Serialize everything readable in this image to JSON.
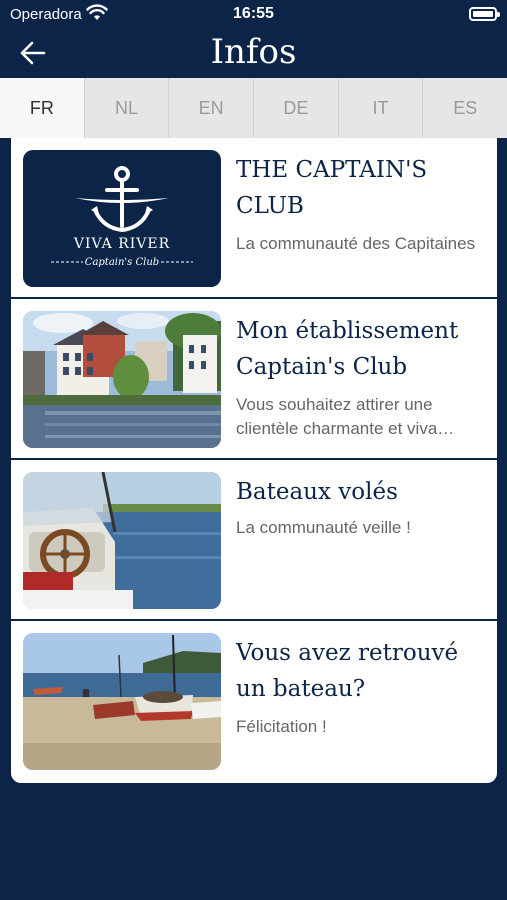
{
  "status_bar": {
    "carrier": "Operadora",
    "time": "16:55"
  },
  "nav": {
    "title": "Infos"
  },
  "languages": [
    {
      "code": "FR",
      "active": true
    },
    {
      "code": "NL",
      "active": false
    },
    {
      "code": "EN",
      "active": false
    },
    {
      "code": "DE",
      "active": false
    },
    {
      "code": "IT",
      "active": false
    },
    {
      "code": "ES",
      "active": false
    }
  ],
  "logo": {
    "brand": "VIVA RIVER",
    "tagline": "Captain's Club"
  },
  "items": [
    {
      "title": "THE CAPTAIN'S CLUB",
      "subtitle": "La communauté des Capitaines",
      "image": "captains-club-logo"
    },
    {
      "title": "Mon établissement Captain's Club",
      "subtitle": "Vous souhaitez attirer une clientèle charmante et viva…",
      "image": "riverside-town-photo"
    },
    {
      "title": "Bateaux volés",
      "subtitle": "La communauté veille !",
      "image": "boat-steering-wheel-photo"
    },
    {
      "title": "Vous avez retrouvé un bateau?",
      "subtitle": "Félicitation !",
      "image": "beach-boats-photo"
    }
  ],
  "colors": {
    "navy": "#0b2447",
    "tab_bg": "#e6e6e6",
    "tab_active": "#f7f7f7"
  }
}
